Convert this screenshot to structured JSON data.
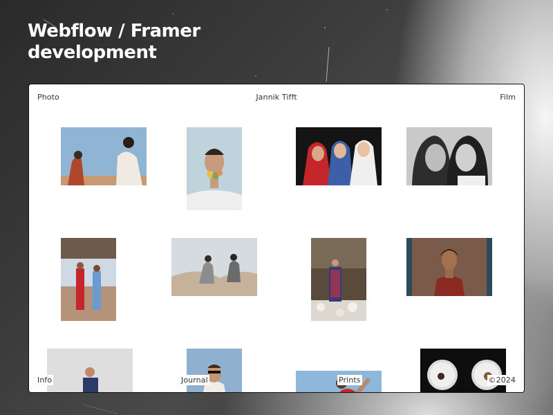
{
  "headline": "Webflow / Framer development",
  "site": {
    "nav_photo": "Photo",
    "brand": "Jannik Tifft",
    "nav_film": "Film",
    "nav_info": "Info",
    "nav_journal": "Journal",
    "nav_prints": "Prints",
    "copyright": "©2024"
  },
  "colors": {
    "frame_bg": "#ffffff",
    "headline": "#ffffff",
    "nav_text": "#333333"
  }
}
